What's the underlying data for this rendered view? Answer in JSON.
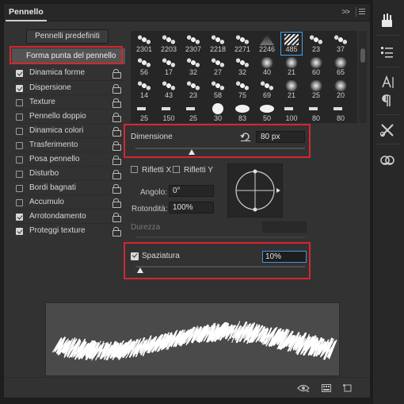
{
  "panel": {
    "title": "Pennello",
    "collapse_glyph": ">>"
  },
  "left": {
    "presets_button": "Pennelli predefiniti",
    "tip_shape": "Forma punta del pennello",
    "options": [
      {
        "label": "Dinamica forme",
        "checked": true
      },
      {
        "label": "Dispersione",
        "checked": true
      },
      {
        "label": "Texture",
        "checked": false
      },
      {
        "label": "Pennello doppio",
        "checked": false
      },
      {
        "label": "Dinamica colori",
        "checked": false
      },
      {
        "label": "Trasferimento",
        "checked": false
      },
      {
        "label": "Posa pennello",
        "checked": false
      },
      {
        "label": "Disturbo",
        "checked": false
      },
      {
        "label": "Bordi bagnati",
        "checked": false
      },
      {
        "label": "Accumulo",
        "checked": false
      },
      {
        "label": "Arrotondamento",
        "checked": true
      },
      {
        "label": "Proteggi texture",
        "checked": true
      }
    ]
  },
  "brushes": {
    "rows": [
      [
        "2301",
        "2203",
        "2307",
        "2218",
        "2271",
        "2246",
        "485",
        "23",
        "37"
      ],
      [
        "56",
        "17",
        "32",
        "27",
        "32",
        "40",
        "21",
        "60",
        "65"
      ],
      [
        "14",
        "43",
        "23",
        "58",
        "75",
        "69",
        "21",
        "25",
        "20"
      ],
      [
        "25",
        "150",
        "25",
        "30",
        "83",
        "50",
        "100",
        "80",
        "80"
      ]
    ],
    "selected": "485"
  },
  "size": {
    "label": "Dimensione",
    "value": "80 px",
    "slider_fraction": 0.33
  },
  "flip": {
    "x_label": "Rifletti X",
    "y_label": "Rifletti Y"
  },
  "angle": {
    "label": "Angolo:",
    "value": "0°"
  },
  "roundness": {
    "label": "Rotondità:",
    "value": "100%"
  },
  "hardness": {
    "label": "Durezza"
  },
  "spacing": {
    "label": "Spaziatura",
    "value": "10%",
    "checked": true,
    "slider_fraction": 0.03
  },
  "colors": {
    "highlight": "#d8252d",
    "focus": "#4a90d9",
    "panel": "#323232"
  }
}
